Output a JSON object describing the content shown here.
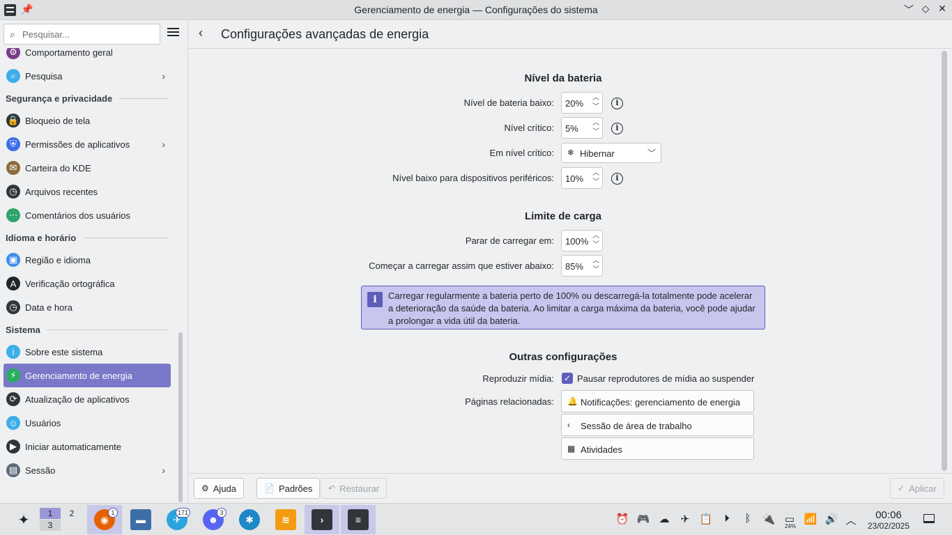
{
  "window": {
    "title": "Gerenciamento de energia — Configurações do sistema",
    "controls": {
      "minimize": "﹀",
      "maximize": "◇",
      "close": "✕"
    }
  },
  "sidebar": {
    "search_placeholder": "Pesquisar...",
    "cut_item": "Comportamento geral",
    "items_top": [
      {
        "label": "Pesquisa",
        "icon": "search-icon",
        "color": "#3daee9",
        "chevron": true
      }
    ],
    "sections": [
      {
        "title": "Segurança e privacidade",
        "items": [
          {
            "label": "Bloqueio de tela",
            "icon": "lock-screen-icon",
            "color": "#31363b",
            "chevron": false
          },
          {
            "label": "Permissões de aplicativos",
            "icon": "shield-icon",
            "color": "#3d6ee9",
            "chevron": true
          },
          {
            "label": "Carteira do KDE",
            "icon": "wallet-icon",
            "color": "#8a6d3b",
            "chevron": false
          },
          {
            "label": "Arquivos recentes",
            "icon": "clock-icon",
            "color": "#31363b",
            "chevron": false
          },
          {
            "label": "Comentários dos usuários",
            "icon": "feedback-icon",
            "color": "#2fa36b",
            "chevron": false
          }
        ]
      },
      {
        "title": "Idioma e horário",
        "items": [
          {
            "label": "Região e idioma",
            "icon": "region-icon",
            "color": "#3d8ee9",
            "chevron": false
          },
          {
            "label": "Verificação ortográfica",
            "icon": "spellcheck-icon",
            "color": "#232629",
            "chevron": false
          },
          {
            "label": "Data e hora",
            "icon": "clock-icon",
            "color": "#31363b",
            "chevron": false
          }
        ]
      },
      {
        "title": "Sistema",
        "items": [
          {
            "label": "Sobre este sistema",
            "icon": "info-icon",
            "color": "#3daee9",
            "chevron": false
          },
          {
            "label": "Gerenciamento de energia",
            "icon": "power-icon",
            "color": "#27ae60",
            "chevron": false,
            "active": true
          },
          {
            "label": "Atualização de aplicativos",
            "icon": "update-icon",
            "color": "#31363b",
            "chevron": false
          },
          {
            "label": "Usuários",
            "icon": "users-icon",
            "color": "#3daee9",
            "chevron": false
          },
          {
            "label": "Iniciar automaticamente",
            "icon": "autostart-icon",
            "color": "#31363b",
            "chevron": false
          },
          {
            "label": "Sessão",
            "icon": "session-icon",
            "color": "#5d6a7a",
            "chevron": true
          }
        ]
      }
    ]
  },
  "header": {
    "title": "Configurações avançadas de energia"
  },
  "battery": {
    "title": "Nível da bateria",
    "low_label": "Nível de bateria baixo:",
    "low_value": "20%",
    "critical_label": "Nível crítico:",
    "critical_value": "5%",
    "action_label": "Em nível crítico:",
    "action_value": "Hibernar",
    "peripheral_label": "Nível baixo para dispositivos periféricos:",
    "peripheral_value": "10%"
  },
  "charge": {
    "title": "Limite de carga",
    "stop_label": "Parar de carregar em:",
    "stop_value": "100%",
    "start_label": "Começar a carregar assim que estiver abaixo:",
    "start_value": "85%",
    "info": "Carregar regularmente a bateria perto de 100% ou descarregá-la totalmente pode acelerar a deterioração da saúde da bateria. Ao limitar a carga máxima da bateria, você pode ajudar a prolongar a vida útil da bateria."
  },
  "other": {
    "title": "Outras configurações",
    "media_label": "Reproduzir mídia:",
    "media_checkbox": "Pausar reprodutores de mídia ao suspender",
    "media_checked": true,
    "related_label": "Páginas relacionadas:",
    "related": [
      {
        "label": "Notificações: gerenciamento de energia",
        "icon": "bell-icon",
        "glyph": "🔔"
      },
      {
        "label": "Sessão de área de trabalho",
        "icon": "chevron-left-icon",
        "glyph": "‹"
      },
      {
        "label": "Atividades",
        "icon": "activities-icon",
        "glyph": "▦"
      }
    ]
  },
  "footer": {
    "help": "Ajuda",
    "defaults": "Padrões",
    "reset": "Restaurar",
    "apply": "Aplicar"
  },
  "taskbar": {
    "pager": [
      "1",
      "2",
      "3"
    ],
    "apps": [
      {
        "name": "firefox",
        "badge": "1",
        "color": "#e66000"
      },
      {
        "name": "files",
        "badge": "",
        "color": "#3d6ea8"
      },
      {
        "name": "telegram",
        "badge": "171",
        "color": "#2aa3df"
      },
      {
        "name": "discord",
        "badge": "3",
        "color": "#5865f2"
      },
      {
        "name": "browser",
        "badge": "",
        "color": "#1e88c8"
      },
      {
        "name": "layers",
        "badge": "",
        "color": "#f39c12"
      },
      {
        "name": "terminal",
        "badge": "",
        "color": "#31363b"
      },
      {
        "name": "system-settings",
        "badge": "",
        "color": "#31363b"
      }
    ],
    "battery_percent": "24%",
    "time": "00:06",
    "date": "23/02/2025"
  },
  "colors": {
    "accent": "#5f5db9",
    "active_item": "#7a78c8",
    "banner_bg": "#c7c6ef"
  }
}
